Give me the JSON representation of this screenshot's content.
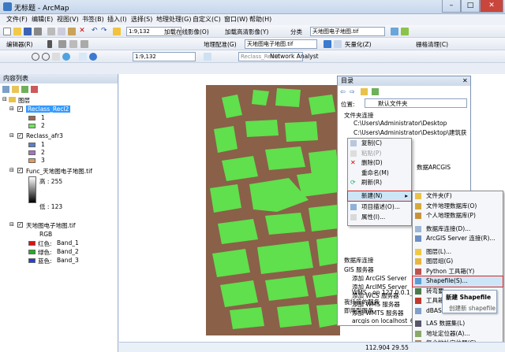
{
  "window": {
    "title": "无标题 - ArcMap",
    "min": "–",
    "max": "□",
    "close": "✕"
  },
  "menu": [
    "文件(F)",
    "编辑(E)",
    "视图(V)",
    "书签(B)",
    "插入(I)",
    "选择(S)",
    "地理处理(G)",
    "自定义(C)",
    "窗口(W)",
    "帮助(H)"
  ],
  "toolbar1": {
    "scale": "1:9,132",
    "add_online": "加载在线影像(O)",
    "add_imagery": "加载高清影像(Y)",
    "classify": "分类",
    "layer_combo": "天地图电子地图.tif"
  },
  "toolbar2": {
    "editor": "编辑器(R)",
    "georef": "地理配准(G)",
    "georef_layer": "天地图电子地图.tif",
    "vectorize": "矢量化(Z)",
    "raster_clean": "栅格清理(C)"
  },
  "toolbar3": {
    "scale": "1:9,132",
    "layer": "Reclass_Recl2",
    "network": "Network Analyst"
  },
  "toc": {
    "title": "内容列表",
    "root": "图层",
    "layers": [
      {
        "name": "Reclass_Recl2",
        "items": [
          {
            "label": "1",
            "color": "#9b6a4f"
          },
          {
            "label": "2",
            "color": "#6fe35a"
          }
        ]
      },
      {
        "name": "Reclass_afr3",
        "items": [
          {
            "label": "1",
            "color": "#5a7fc9"
          },
          {
            "label": "2",
            "color": "#a673c6"
          },
          {
            "label": "3",
            "color": "#e59a5c"
          }
        ]
      },
      {
        "name": "Func_天地图电子地图.tif",
        "high": "高 : 255",
        "low": "低 : 123"
      },
      {
        "name": "天地图电子地图.tif",
        "rgb": "RGB",
        "bands": [
          {
            "label": "红色:",
            "band": "Band_1",
            "color": "#e01010"
          },
          {
            "label": "绿色:",
            "band": "Band_2",
            "color": "#20b020"
          },
          {
            "label": "蓝色:",
            "band": "Band_3",
            "color": "#2040e0"
          }
        ]
      }
    ]
  },
  "catalog": {
    "title": "目录",
    "location_label": "位置:",
    "location_value": "默认文件夹",
    "tree": [
      "文件夹连接",
      "C:\\Users\\Administrator\\Desktop",
      "C:\\Users\\Administrator\\Desktop\\建筑获取",
      "E",
      "F",
      "H",
      "I",
      "本",
      "数据库连接",
      "GIS 服务器",
      "添加 ArcGIS Server",
      "添加 ArcIMS Server",
      "添加 WCS 服务器",
      "添加 WMS 服务器",
      "添加 WMTS 服务器",
      "arcgis on localhost_60",
      "WMS - on 127.0.0.1_300",
      "我托管的服务",
      "即用型服务"
    ],
    "partial_text": "数据ARCGIS"
  },
  "context_menu": {
    "items": [
      "复制(C)",
      "粘贴(P)",
      "删除(D)",
      "重命名(M)",
      "刷新(R)",
      "新建(N)",
      "项目描述(O)...",
      "属性(I)..."
    ],
    "arrow": "▸"
  },
  "submenu": {
    "items": [
      "文件夹(F)",
      "文件地理数据库(O)",
      "个人地理数据库(P)",
      "数据库连接(D)...",
      "ArcGIS Server 连接(R)...",
      "图层(L)...",
      "图层组(G)",
      "Python 工具箱(Y)",
      "Shapefile(S)...",
      "转弯要",
      "工具箱",
      "dBASE",
      "LAS 数据集(L)",
      "地址定位器(A)...",
      "复合地址定位器(C)..."
    ]
  },
  "tooltip": {
    "title": "新建 Shapefile",
    "body": "创建新 shapefile"
  },
  "status": {
    "coords": "112.904  29.55"
  },
  "colors": {
    "raster_brown": "#8a6049",
    "building_green": "#5fe04c",
    "accent": "#1f5fa6"
  }
}
